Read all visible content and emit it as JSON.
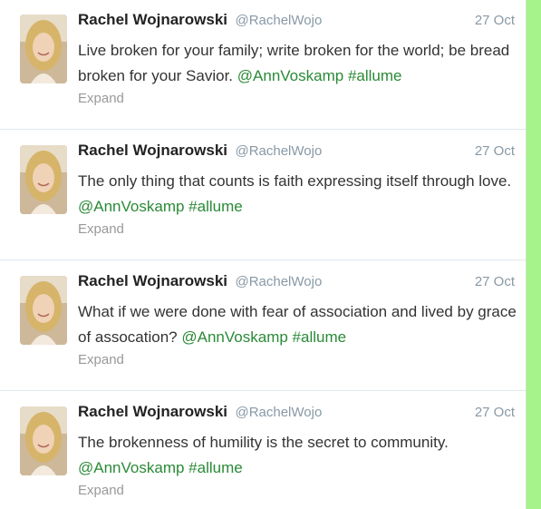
{
  "tweets": [
    {
      "fullname": "Rachel Wojnarowski",
      "handle": "@RachelWojo",
      "time": "27 Oct",
      "text": "Live broken for your family; write broken for the world; be bread broken for your Savior.",
      "mention": "@AnnVoskamp",
      "hashtag": "#allume",
      "expand": "Expand"
    },
    {
      "fullname": "Rachel Wojnarowski",
      "handle": "@RachelWojo",
      "time": "27 Oct",
      "text": "The only thing that counts is faith expressing itself through love.",
      "mention": "@AnnVoskamp",
      "hashtag": "#allume",
      "expand": "Expand"
    },
    {
      "fullname": "Rachel Wojnarowski",
      "handle": "@RachelWojo",
      "time": "27 Oct",
      "text": "What if we were done with fear of association and lived by grace of assocation?",
      "mention": "@AnnVoskamp",
      "hashtag": "#allume",
      "expand": "Expand"
    },
    {
      "fullname": "Rachel Wojnarowski",
      "handle": "@RachelWojo",
      "time": "27 Oct",
      "text": "The brokenness of humility is the secret to community.",
      "mention": "@AnnVoskamp",
      "hashtag": "#allume",
      "expand": "Expand"
    }
  ],
  "colors": {
    "page_background": "#a6f28b",
    "link": "#2a8a36",
    "muted": "#8899a6"
  },
  "icons": {
    "avatar": "profile-photo"
  }
}
